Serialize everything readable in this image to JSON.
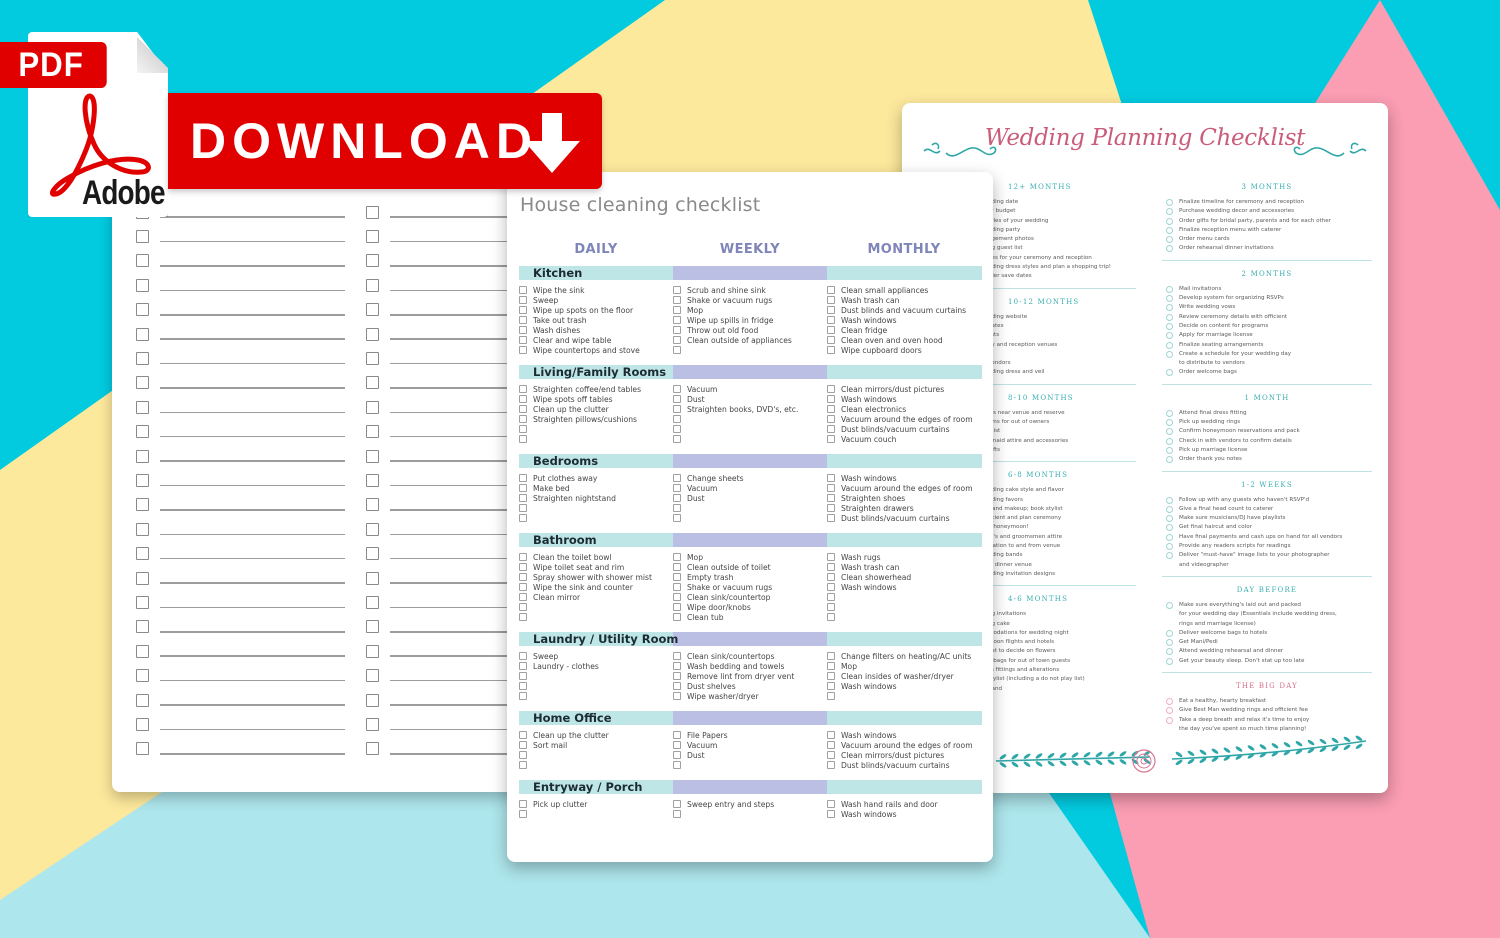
{
  "badge": {
    "pdf_label": "PDF",
    "brand": "Adobe",
    "download_label": "DOWNLOAD",
    "colors": {
      "red": "#e00000",
      "white": "#ffffff"
    },
    "icons": [
      "acrobat-logo-icon",
      "download-arrow-icon"
    ]
  },
  "background_colors": {
    "cyan": "#02cbe0",
    "yellow": "#fde99c",
    "light_cyan": "#ade6ec",
    "pink": "#fb9db3"
  },
  "blank_checklist": {
    "rows_per_column": 23,
    "columns": 2
  },
  "house_checklist": {
    "title": "House cleaning checklist",
    "columns": [
      "DAILY",
      "WEEKLY",
      "MONTHLY"
    ],
    "colors": {
      "teal_bar": "#bfe6e7",
      "lavender_bar": "#bcbfe4",
      "heading": "#7f85b8"
    },
    "sections": [
      {
        "name": "Kitchen",
        "daily": [
          "Wipe the sink",
          "Sweep",
          "Wipe up spots on the floor",
          "Take out trash",
          "Wash dishes",
          "Clear and wipe table",
          "Wipe countertops and stove"
        ],
        "weekly": [
          "Scrub and shine sink",
          "Shake or vacuum rugs",
          "Mop",
          "Wipe up spills in fridge",
          "Throw out old food",
          "Clean outside of appliances",
          ""
        ],
        "monthly": [
          "Clean small appliances",
          "Wash trash can",
          "Dust blinds and vacuum curtains",
          "Wash windows",
          "Clean fridge",
          "Clean oven and oven hood",
          "Wipe cupboard doors"
        ]
      },
      {
        "name": "Living/Family Rooms",
        "daily": [
          "Straighten coffee/end tables",
          "Wipe spots off tables",
          "Clean up the clutter",
          "Straighten pillows/cushions",
          "",
          ""
        ],
        "weekly": [
          "Vacuum",
          "Dust",
          "Straighten books, DVD's, etc.",
          "",
          "",
          ""
        ],
        "monthly": [
          "Clean mirrors/dust pictures",
          "Wash windows",
          "Clean electronics",
          "Vacuum around the edges of room",
          "Dust blinds/vacuum curtains",
          "Vacuum couch"
        ]
      },
      {
        "name": "Bedrooms",
        "daily": [
          "Put clothes away",
          "Make bed",
          "Straighten nightstand",
          "",
          ""
        ],
        "weekly": [
          "Change sheets",
          "Vacuum",
          "Dust",
          "",
          ""
        ],
        "monthly": [
          "Wash windows",
          "Vacuum around the edges of room",
          "Straighten shoes",
          "Straighten drawers",
          "Dust blinds/vacuum curtains"
        ]
      },
      {
        "name": "Bathroom",
        "daily": [
          "Clean the toilet bowl",
          "Wipe toilet seat and rim",
          "Spray shower with shower mist",
          "Wipe the sink and counter",
          "Clean mirror",
          "",
          ""
        ],
        "weekly": [
          "Mop",
          "Clean outside of toilet",
          "Empty trash",
          "Shake or vacuum rugs",
          "Clean sink/countertop",
          "Wipe door/knobs",
          "Clean tub"
        ],
        "monthly": [
          "Wash rugs",
          "Wash trash can",
          "Clean showerhead",
          "Wash windows",
          "",
          "",
          ""
        ]
      },
      {
        "name": "Laundry / Utility Room",
        "daily": [
          "Sweep",
          "Laundry - clothes",
          "",
          "",
          ""
        ],
        "weekly": [
          "Clean sink/countertops",
          "Wash bedding and towels",
          "Remove lint from dryer vent",
          "Dust shelves",
          "Wipe washer/dryer"
        ],
        "monthly": [
          "Change filters on heating/AC units",
          "Mop",
          "Clean insides of washer/dryer",
          "Wash windows",
          ""
        ]
      },
      {
        "name": "Home Office",
        "daily": [
          "Clean up the clutter",
          "Sort mail",
          "",
          ""
        ],
        "weekly": [
          "File Papers",
          "Vacuum",
          "Dust",
          ""
        ],
        "monthly": [
          "Wash windows",
          "Vacuum around the edges of room",
          "Clean mirrors/dust pictures",
          "Dust blinds/vacuum curtains"
        ]
      },
      {
        "name": "Entryway / Porch",
        "daily": [
          "Pick up clutter",
          ""
        ],
        "weekly": [
          "Sweep entry and steps",
          ""
        ],
        "monthly": [
          "Wash hand rails and door",
          "Wash windows"
        ]
      }
    ]
  },
  "wedding_checklist": {
    "title": "Wedding Planning Checklist",
    "colors": {
      "title": "#c95c7a",
      "heading": "#39aeb0",
      "accent_pink": "#d56d8a"
    },
    "left_column": [
      {
        "heading": "12+ MONTHS",
        "items": [
          "dding date",
          "ur budget",
          "tyles of your wedding",
          "dding party",
          "agement photos",
          "ng guest list",
          "ues for your ceremony and reception",
          "dding dress styles and plan a shopping trip!",
          "rder save dates"
        ]
      },
      {
        "heading": "10-12 MONTHS",
        "items": [
          "dding website",
          "dates",
          "lists",
          "ny and reception venues",
          "ir",
          "vendors",
          "dding dress and veil"
        ]
      },
      {
        "heading": "8-10 MONTHS",
        "items": [
          "els near venue and reserve",
          "oms for out of owners",
          "t list",
          "smaid attire and accessories",
          "gifts"
        ]
      },
      {
        "heading": "6-8 MONTHS",
        "items": [
          "dding cake style and flavor",
          "dding favors",
          "r and makeup; book stylist",
          "ficient and plan ceremony",
          "g honeymoon!",
          "m's and groomsmen attire",
          "rtation to and from venue",
          "dding bands",
          "al dinner venue",
          "dding invitation designs"
        ]
      },
      {
        "heading": "4-6 MONTHS",
        "items": [
          "ng invitations",
          "ng cake",
          "modations for wedding night",
          "moon flights and hotels",
          "rist to decide on flowers",
          "e bags for out of town guests",
          "ss fittings and alterations",
          "laylist (including a do not play list)",
          "hand",
          "s"
        ]
      }
    ],
    "right_column": [
      {
        "heading": "3 MONTHS",
        "items": [
          "Finalize timeline for ceremony and reception",
          "Purchase wedding decor and accessories",
          "Order gifts for bridal party, parents and for each other",
          "Finalize reception menu with caterer",
          "Order menu cards",
          "Order rehearsal dinner invitations"
        ]
      },
      {
        "heading": "2 MONTHS",
        "items": [
          "Mail invitations",
          "Develop system for organizing RSVPs",
          "Write wedding vows",
          "Review ceremony details with officient",
          "Decide on content for programs",
          "Apply for marriage license",
          "Finalize seating arrangements",
          "Create a schedule for your wedding day|to distribute to vendors",
          "Order welcome bags"
        ]
      },
      {
        "heading": "1 MONTH",
        "items": [
          "Attend final dress fitting",
          "Pick up wedding rings",
          "Confirm honeymoon reservations and pack",
          "Check in with vendors to confirm details",
          "Pick up marriage license",
          "Order thank you notes"
        ]
      },
      {
        "heading": "1-2 WEEKS",
        "items": [
          "Follow up with any guests who haven't RSVP'd",
          "Give a final head count to caterer",
          "Make sure musicians/DJ have playlists",
          "Get final haircut and color",
          "Have final payments and cash ups on hand for all vendors",
          "Provide any readers scripts for readings",
          "Deliver \"must-have\" image lists to your photographer|and videographer"
        ]
      },
      {
        "heading": "DAY BEFORE",
        "items": [
          "Make sure everything's laid out and packed|for your wedding day (Essentials include wedding dress,|rings and marriage license)",
          "Deliver welcome bags to hotels",
          "Get Mani/Pedi",
          "Attend wedding rehearsal and dinner",
          "Get your beauty sleep. Don't stat up too late"
        ]
      },
      {
        "heading": "THE BIG DAY",
        "pink": true,
        "items": [
          "Eat a healthy, hearty breakfast",
          "Give Best Man wedding rings and officient fee",
          "Take a deep breath and relax it's time to enjoy|the day you've spent so much time planning!"
        ]
      }
    ]
  }
}
